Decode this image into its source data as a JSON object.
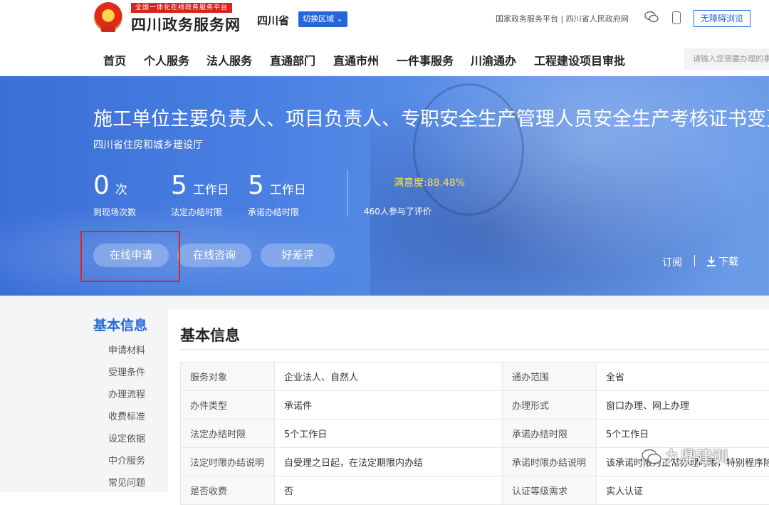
{
  "header": {
    "badge": "全国一体化在线政务服务平台",
    "site_title": "四川政务服务网",
    "province": "四川省",
    "switch_region": "切换区域 ⌄",
    "top_links": "国家政务服务平台 | 四川省人民政府网",
    "accessibility": "无障碍浏览"
  },
  "nav": {
    "items": [
      "首页",
      "个人服务",
      "法人服务",
      "直通部门",
      "直通市州",
      "一件事服务",
      "川渝通办",
      "工程建设项目审批"
    ],
    "search_placeholder": "请输入您需要办理的事项"
  },
  "banner": {
    "title": "施工单位主要负责人、项目负责人、专职安全生产管理人员安全生产考核证书变更",
    "department": "四川省住房和城乡建设厅",
    "stats": [
      {
        "num": "0",
        "unit": "次",
        "label": "到现场次数"
      },
      {
        "num": "5",
        "unit": "工作日",
        "label": "法定办结时限"
      },
      {
        "num": "5",
        "unit": "工作日",
        "label": "承诺办结时限"
      }
    ],
    "satisfaction": "满意度:88.48%",
    "rating_count": "460人参与了评价",
    "buttons": [
      "在线申请",
      "在线咨询",
      "好差评"
    ],
    "subscribe": "订阅",
    "download": "下载"
  },
  "sidebar": {
    "title": "基本信息",
    "items": [
      "申请材料",
      "受理条件",
      "办理流程",
      "收费标准",
      "设定依据",
      "中介服务",
      "常见问题"
    ]
  },
  "panel": {
    "title": "基本信息",
    "rows": [
      [
        "服务对象",
        "企业法人、自然人",
        "通办范围",
        "全省"
      ],
      [
        "办件类型",
        "承诺件",
        "办理形式",
        "窗口办理、网上办理"
      ],
      [
        "法定办结时限",
        "5个工作日",
        "承诺办结时限",
        "5个工作日"
      ],
      [
        "法定时限办结说明",
        "自受理之日起，在法定期限内办结",
        "承诺时限办结说明",
        "该承诺时限为正常办理时限，特别程序除外"
      ],
      [
        "是否收费",
        "否",
        "认证等级需求",
        "实人认证"
      ]
    ]
  },
  "watermark": "九鼎建训",
  "colors": {
    "primary": "#2766d9",
    "highlight": "#e0251c",
    "satisfaction": "#ffe04a"
  }
}
